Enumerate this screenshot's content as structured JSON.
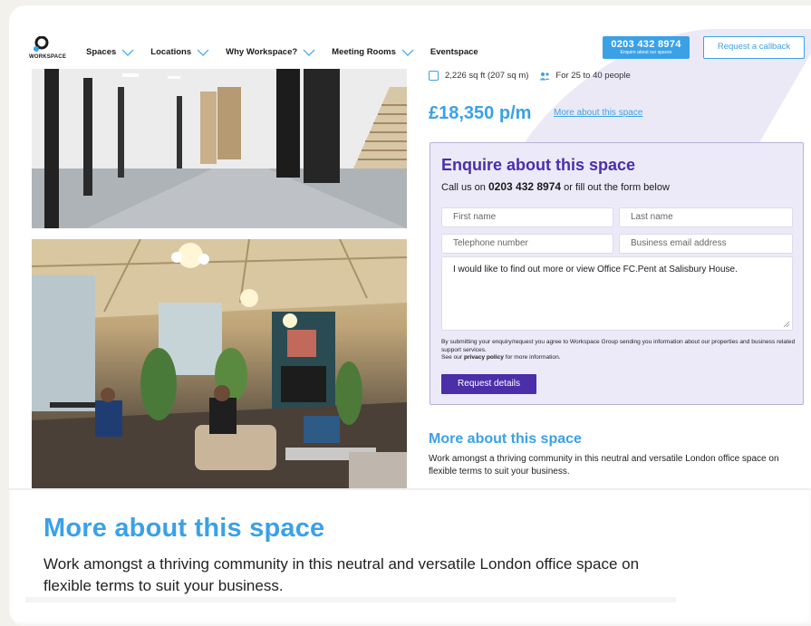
{
  "header": {
    "logo_text": "WORKSPACE",
    "nav": [
      {
        "label": "Spaces",
        "has_dropdown": true
      },
      {
        "label": "Locations",
        "has_dropdown": true
      },
      {
        "label": "Why Workspace?",
        "has_dropdown": true
      },
      {
        "label": "Meeting Rooms",
        "has_dropdown": true
      },
      {
        "label": "Eventspace",
        "has_dropdown": false
      }
    ],
    "phone_button": {
      "number": "0203 432 8974",
      "sub": "Enquire about our spaces"
    },
    "callback_label": "Request a callback"
  },
  "space": {
    "area": "2,226 sq ft (207 sq m)",
    "capacity": "For 25 to 40 people",
    "price": "£18,350 p/m",
    "more_link": "More about this space"
  },
  "enquire": {
    "title": "Enquire about this space",
    "sub_prefix": "Call us on ",
    "sub_phone": "0203 432 8974",
    "sub_suffix": " or fill out the form below",
    "first_name_placeholder": "First name",
    "last_name_placeholder": "Last name",
    "telephone_placeholder": "Telephone number",
    "email_placeholder": "Business email address",
    "message_value": "I would like to find out more or view Office FC.Pent at Salisbury House.",
    "disclaimer_1": "By submitting your enquiry/request you agree to Workspace Group sending you information about our properties and business related support services.",
    "disclaimer_2_prefix": "See our ",
    "disclaimer_2_link": "privacy policy",
    "disclaimer_2_suffix": " for more information.",
    "submit_label": "Request details"
  },
  "more": {
    "title": "More about this space",
    "text": "Work amongst a thriving community in this neutral and versatile London office space on flexible terms to suit your business."
  },
  "colors": {
    "accent_blue": "#3aa1e6",
    "accent_purple": "#4b2ea8",
    "form_bg": "#eceaf9"
  },
  "icons": [
    "chevron-down-icon",
    "area-icon",
    "people-icon",
    "resize-handle-icon",
    "workspace-logo-icon"
  ]
}
